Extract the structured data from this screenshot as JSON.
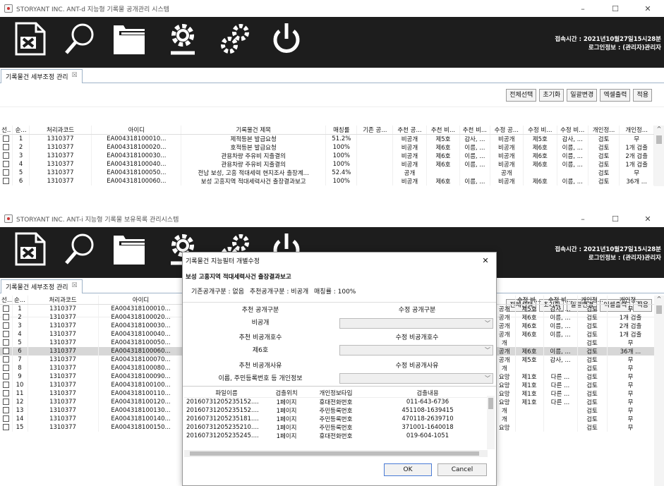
{
  "win1": {
    "title": "STORYANT INC. ANT-d 지능형 기록물 공개관리 시스템",
    "tab": "기록물건 세부조정 관리",
    "tab_close": "☒",
    "session_time": "접속시간 : 2021년10월27일15시28분",
    "login_info": "로그인정보 : (관리자)관리자",
    "buttons": [
      "전체선택",
      "초기화",
      "일괄변경",
      "엑셀출력",
      "적용"
    ],
    "headers": [
      "선..",
      "순...",
      "처리과코드",
      "아이디",
      "기록물건 제목",
      "매칭률",
      "기존 공...",
      "추천 공...",
      "추천 비...",
      "추천 비...",
      "수정 공...",
      "수정 비...",
      "수정 비...",
      "개인정...",
      "개인정..."
    ],
    "rows": [
      [
        "1",
        "1310377",
        "EA004318100010...",
        "제적등본 발급요청",
        "51.2%",
        "",
        "비공개",
        "제5호",
        "감사, ...",
        "비공개",
        "제5호",
        "감사, ...",
        "검토",
        "무"
      ],
      [
        "2",
        "1310377",
        "EA004318100020...",
        "호적등본 발급요청",
        "100%",
        "",
        "비공개",
        "제6호",
        "이름, ...",
        "비공개",
        "제6호",
        "이름, ...",
        "검토",
        "1개 검출"
      ],
      [
        "3",
        "1310377",
        "EA004318100030...",
        "관용차량 주유비 지출결의",
        "100%",
        "",
        "비공개",
        "제6호",
        "이름, ...",
        "비공개",
        "제6호",
        "이름, ...",
        "검토",
        "2개 검출"
      ],
      [
        "4",
        "1310377",
        "EA004318100040...",
        "관용차량 주유비 지출결의",
        "100%",
        "",
        "비공개",
        "제6호",
        "이름, ...",
        "비공개",
        "제6호",
        "이름, ...",
        "검토",
        "1개 검출"
      ],
      [
        "5",
        "1310377",
        "EA004318100050...",
        "전남 보성, 고흥 적대세력 현지조사 출장계...",
        "52.4%",
        "",
        "공개",
        "",
        "",
        "공개",
        "",
        "",
        "검토",
        "무"
      ],
      [
        "6",
        "1310377",
        "EA004318100060...",
        "보성 고흥지역 적대세력사건 출장결과보고",
        "100%",
        "",
        "비공개",
        "제6호",
        "이름, ...",
        "비공개",
        "제6호",
        "이름, ...",
        "검토",
        "36개 ..."
      ]
    ]
  },
  "win2": {
    "title": "STORYANT INC. ANT-i 지능형 기록물 보유목록 관리시스템",
    "tab": "기록물건 세부조정 관리",
    "tab_close": "☒",
    "session_time": "접속시간 : 2021년10월27일15시28분",
    "login_info": "로그인정보 : (관리자)관리자",
    "buttons": [
      "전체선택",
      "초기화",
      "일괄변경",
      "엑셀출력",
      "적용"
    ],
    "headers": [
      "선..",
      "순...",
      "처리과코드",
      "아이디"
    ],
    "rows": [
      [
        "1",
        "1310377",
        "EA004318100010..."
      ],
      [
        "2",
        "1310377",
        "EA004318100020..."
      ],
      [
        "3",
        "1310377",
        "EA004318100030..."
      ],
      [
        "4",
        "1310377",
        "EA004318100040..."
      ],
      [
        "5",
        "1310377",
        "EA004318100050..."
      ],
      [
        "6",
        "1310377",
        "EA004318100060..."
      ],
      [
        "7",
        "1310377",
        "EA004318100070..."
      ],
      [
        "8",
        "1310377",
        "EA004318100080..."
      ],
      [
        "9",
        "1310377",
        "EA004318100090..."
      ],
      [
        "10",
        "1310377",
        "EA004318100100..."
      ],
      [
        "11",
        "1310377",
        "EA004318100110..."
      ],
      [
        "12",
        "1310377",
        "EA004318100120..."
      ],
      [
        "13",
        "1310377",
        "EA004318100130..."
      ],
      [
        "14",
        "1310377",
        "EA004318100140..."
      ],
      [
        "15",
        "1310377",
        "EA004318100150..."
      ]
    ],
    "right_headers": [
      "수정 비...",
      "수정 비...",
      "개인정...",
      "개인정..."
    ],
    "right_rows": [
      [
        "공개",
        "제5호",
        "감사, ...",
        "검토",
        "무"
      ],
      [
        "공개",
        "제6호",
        "이름, ...",
        "검토",
        "1개 검출"
      ],
      [
        "공개",
        "제6호",
        "이름, ...",
        "검토",
        "2개 검출"
      ],
      [
        "공개",
        "제6호",
        "이름, ...",
        "검토",
        "1개 검출"
      ],
      [
        "개",
        "",
        "",
        "검토",
        "무"
      ],
      [
        "공개",
        "제6호",
        "이름, ...",
        "검토",
        "36개 ..."
      ],
      [
        "공개",
        "제5호",
        "감사, ...",
        "검토",
        "무"
      ],
      [
        "개",
        "",
        "",
        "검토",
        "무"
      ],
      [
        "요망",
        "제1호",
        "다른 ...",
        "검토",
        "무"
      ],
      [
        "요망",
        "제1호",
        "다른 ...",
        "검토",
        "무"
      ],
      [
        "요망",
        "제1호",
        "다른 ...",
        "검토",
        "무"
      ],
      [
        "요망",
        "제1호",
        "다른 ...",
        "검토",
        "무"
      ],
      [
        "개",
        "",
        "",
        "검토",
        "무"
      ],
      [
        "개",
        "",
        "",
        "검토",
        "무"
      ],
      [
        "요망",
        "",
        "",
        "검토",
        "무"
      ]
    ]
  },
  "dialog": {
    "title": "기록물건 지능필터 개별수정",
    "close": "✕",
    "record_title": "보성 고흥지역 적대세력사건 출장결과보고",
    "sub": [
      "기존공개구분 : 없음",
      "추천공개구분 : 비공개",
      "매칭률 : 100%"
    ],
    "rec_disclosure_label": "추천 공개구분",
    "rec_disclosure_value": "비공개",
    "mod_disclosure_label": "수정 공개구분",
    "rec_nondisc_no_label": "추천 비공개호수",
    "rec_nondisc_no_value": "제6호",
    "mod_nondisc_no_label": "수정 비공개호수",
    "rec_reason_label": "추천 비공개사유",
    "rec_reason_value": "이름, 주민등록번호 등 개인정보",
    "mod_reason_label": "수정 비공개사유",
    "file_headers": [
      "파일이름",
      "검출위치",
      "개인정보타입",
      "검출내용"
    ],
    "files": [
      [
        "2016073120523515​2....",
        "1페이지",
        "휴대전화번호",
        "011-643-6736"
      ],
      [
        "2016073120523515​2....",
        "1페이지",
        "주민등록번호",
        "451108-1639415"
      ],
      [
        "2016073120523518​1....",
        "1페이지",
        "주민등록번호",
        "470118-2639710"
      ],
      [
        "2016073120523521​0....",
        "1페이지",
        "주민등록번호",
        "371001-1640018"
      ],
      [
        "2016073120523524​5....",
        "1페이지",
        "휴대전화번호",
        "019-604-1051"
      ]
    ],
    "ok": "OK",
    "cancel": "Cancel"
  }
}
